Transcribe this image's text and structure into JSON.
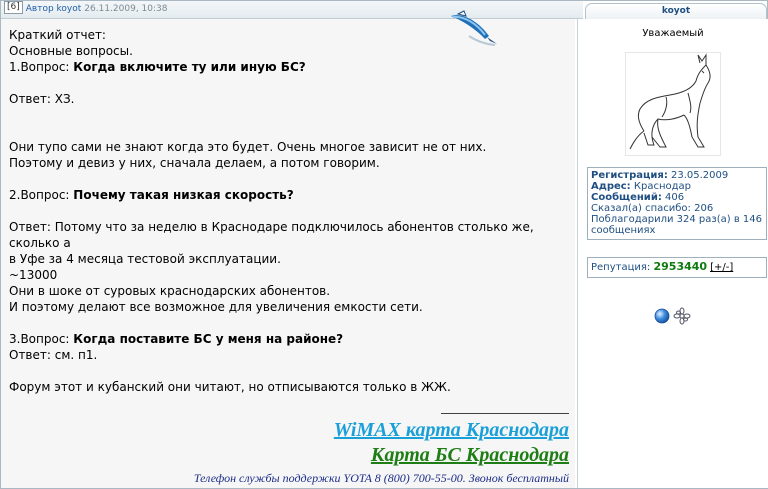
{
  "header": {
    "post_number": "[6]",
    "author_link": "Автор koyot",
    "date": "26.11.2009, 10:38",
    "user_tab": "koyot"
  },
  "post": {
    "lines": {
      "l1": "Краткий отчет:",
      "l2": "Основные вопросы.",
      "q1_prefix": "1.Вопрос: ",
      "q1_bold": "Когда включите ту или иную БС?",
      "a1": "Ответ: ХЗ.",
      "p1": "Они тупо сами не знают когда это будет. Очень многое зависит не от них.",
      "p2": "Поэтому и девиз у них, сначала делаем, а потом говорим.",
      "q2_prefix": "2.Вопрос: ",
      "q2_bold": "Почему такая низкая скорость?",
      "a2a": "Ответ: Потому что за неделю в Краснодаре подключилось абонентов столько же, сколько а",
      "a2b": "в Уфе за 4 месяца тестовой эксплуатации.",
      "a2c": "~13000",
      "a2d": "Они в шоке от суровых краснодарских абонентов.",
      "a2e": "И поэтому делают все возможное для увеличения емкости сети.",
      "q3_prefix": "3.Вопрос: ",
      "q3_bold": "Когда поставите БС у меня на районе?",
      "a3": "Ответ: см. п1.",
      "last": "Форум этот и кубанский они читают, но отписываются только в ЖЖ."
    }
  },
  "signature": {
    "wimax_link": "WiMAX карта Краснодара",
    "bs_link": "Карта БС Краснодара",
    "phone": "Телефон службы поддержки YOTA 8 (800) 700-55-00. Звонок бесплатный"
  },
  "user": {
    "rank": "Уважаемый",
    "registration_label": "Регистрация:",
    "registration_value": "23.05.2009",
    "address_label": "Адрес:",
    "address_value": "Краснодар",
    "messages_label": "Сообщений:",
    "messages_value": "406",
    "thanks_said": "Сказал(а) спасибо: 206",
    "thanked": "Поблагодарили 324 раз(а) в 146 сообщениях",
    "reputation_label": "Репутация:",
    "reputation_value": "2953440",
    "reputation_link": "[+/-]"
  },
  "colors": {
    "link_blue": "#1f5fa8",
    "wimax_cyan": "#1aa0d8",
    "bs_green": "#1e7d14",
    "phone_navy": "#1e2f8a",
    "reputation_green": "#0f7a0f",
    "post_background": "#f6f6f6"
  },
  "icons": {
    "quill": "feather-pen-icon",
    "avatar": "howling-wolf-avatar",
    "online": "online-status-icon",
    "icq": "icq-flower-icon"
  }
}
